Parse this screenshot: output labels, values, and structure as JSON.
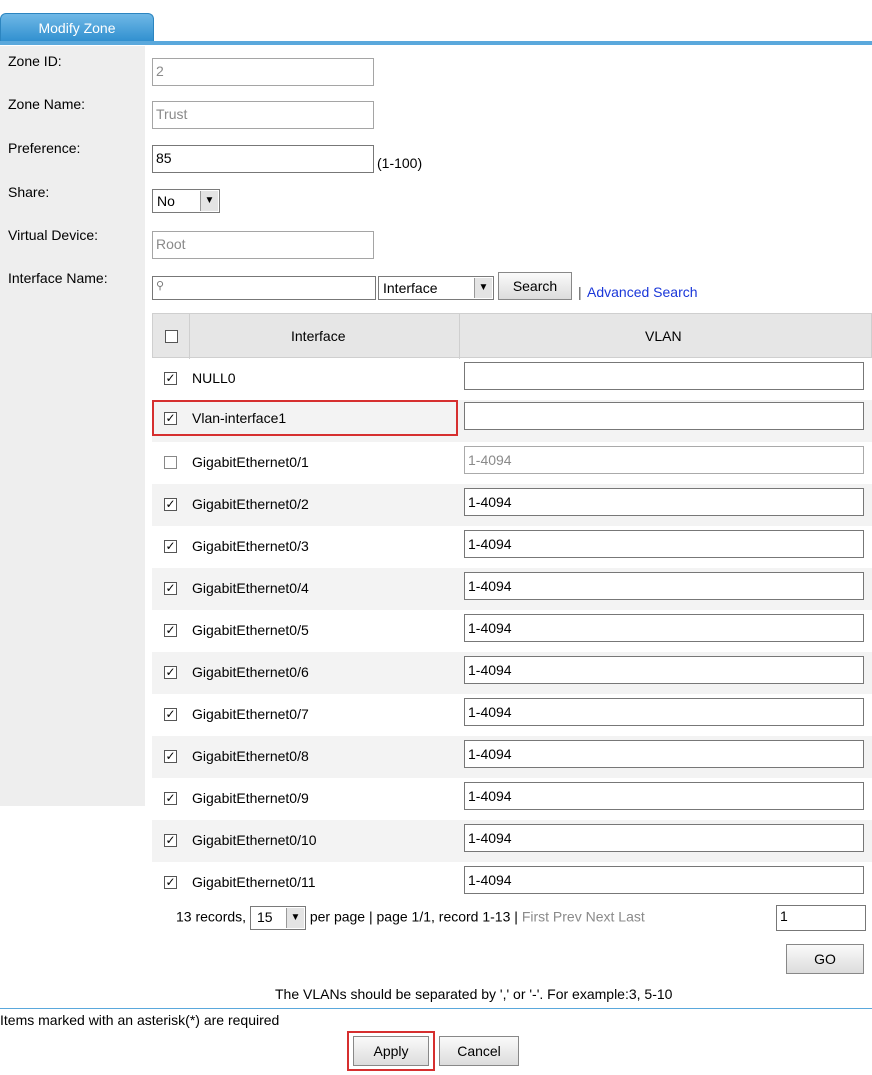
{
  "tab": {
    "label": "Modify Zone"
  },
  "form": {
    "zone_id": {
      "label": "Zone ID:",
      "value": "2"
    },
    "zone_name": {
      "label": "Zone Name:",
      "value": "Trust"
    },
    "preference": {
      "label": "Preference:",
      "value": "85",
      "hint": "(1-100)"
    },
    "share": {
      "label": "Share:",
      "value": "No"
    },
    "virtual_device": {
      "label": "Virtual Device:",
      "value": "Root"
    },
    "interface_name": {
      "label": "Interface Name:",
      "search_value": "",
      "filter": "Interface",
      "search_button": "Search",
      "separator": "|",
      "advanced_search": "Advanced Search"
    }
  },
  "table": {
    "headers": {
      "interface": "Interface",
      "vlan": "VLAN"
    },
    "rows": [
      {
        "name": "NULL0",
        "checked": true,
        "vlan": "",
        "enabled": true
      },
      {
        "name": "Vlan-interface1",
        "checked": true,
        "vlan": "",
        "enabled": true
      },
      {
        "name": "GigabitEthernet0/1",
        "checked": false,
        "vlan": "1-4094",
        "enabled": false
      },
      {
        "name": "GigabitEthernet0/2",
        "checked": true,
        "vlan": "1-4094",
        "enabled": true
      },
      {
        "name": "GigabitEthernet0/3",
        "checked": true,
        "vlan": "1-4094",
        "enabled": true
      },
      {
        "name": "GigabitEthernet0/4",
        "checked": true,
        "vlan": "1-4094",
        "enabled": true
      },
      {
        "name": "GigabitEthernet0/5",
        "checked": true,
        "vlan": "1-4094",
        "enabled": true
      },
      {
        "name": "GigabitEthernet0/6",
        "checked": true,
        "vlan": "1-4094",
        "enabled": true
      },
      {
        "name": "GigabitEthernet0/7",
        "checked": true,
        "vlan": "1-4094",
        "enabled": true
      },
      {
        "name": "GigabitEthernet0/8",
        "checked": true,
        "vlan": "1-4094",
        "enabled": true
      },
      {
        "name": "GigabitEthernet0/9",
        "checked": true,
        "vlan": "1-4094",
        "enabled": true
      },
      {
        "name": "GigabitEthernet0/10",
        "checked": true,
        "vlan": "1-4094",
        "enabled": true
      },
      {
        "name": "GigabitEthernet0/11",
        "checked": true,
        "vlan": "1-4094",
        "enabled": true
      }
    ]
  },
  "pager": {
    "records": "13 records,",
    "per_page_value": "15",
    "per_page_text": "per page | page 1/1, record 1-13 |",
    "first": "First",
    "prev": "Prev",
    "next": "Next",
    "last": "Last",
    "page_input": "1",
    "go": "GO"
  },
  "note": "The VLANs should be separated by ',' or '-'. For example:3, 5-10",
  "required_note": "Items marked with an asterisk(*) are required",
  "buttons": {
    "apply": "Apply",
    "cancel": "Cancel"
  },
  "colors": {
    "tab": "#2f8fcf",
    "link": "#1a37d9",
    "highlight": "#d62f2f"
  }
}
